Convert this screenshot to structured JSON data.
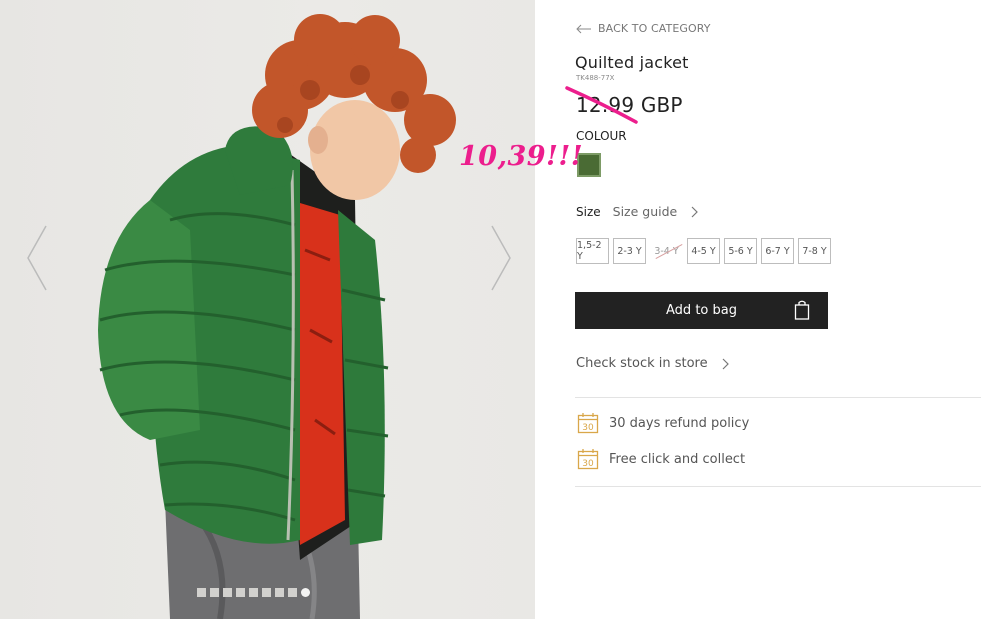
{
  "navigation": {
    "back_label": "BACK TO CATEGORY"
  },
  "product": {
    "title": "Quilted jacket",
    "sku": "TK488-77X",
    "price": "12.99 GBP",
    "handwritten_price": "10,39!!!"
  },
  "colour": {
    "label": "COLOUR",
    "selected_swatch": "#4a6b34"
  },
  "size": {
    "label": "Size",
    "guide_label": "Size guide",
    "options": [
      {
        "label": "1,5-2 Y",
        "available": true
      },
      {
        "label": "2-3 Y",
        "available": true
      },
      {
        "label": "3-4 Y",
        "available": false
      },
      {
        "label": "4-5 Y",
        "available": true
      },
      {
        "label": "5-6 Y",
        "available": true
      },
      {
        "label": "6-7 Y",
        "available": true
      },
      {
        "label": "7-8 Y",
        "available": true
      }
    ]
  },
  "cart": {
    "add_label": "Add to bag"
  },
  "store": {
    "check_label": "Check stock in store"
  },
  "features": [
    {
      "icon": "calendar-icon",
      "icon_text": "30",
      "label": "30 days refund policy"
    },
    {
      "icon": "calendar-icon",
      "icon_text": "30",
      "label": "Free click and collect"
    }
  ],
  "gallery": {
    "image_count": 9,
    "active_index": 8
  },
  "colors": {
    "accent": "#222222",
    "annotation": "#ec1e8d",
    "icon": "#d9a74a"
  }
}
